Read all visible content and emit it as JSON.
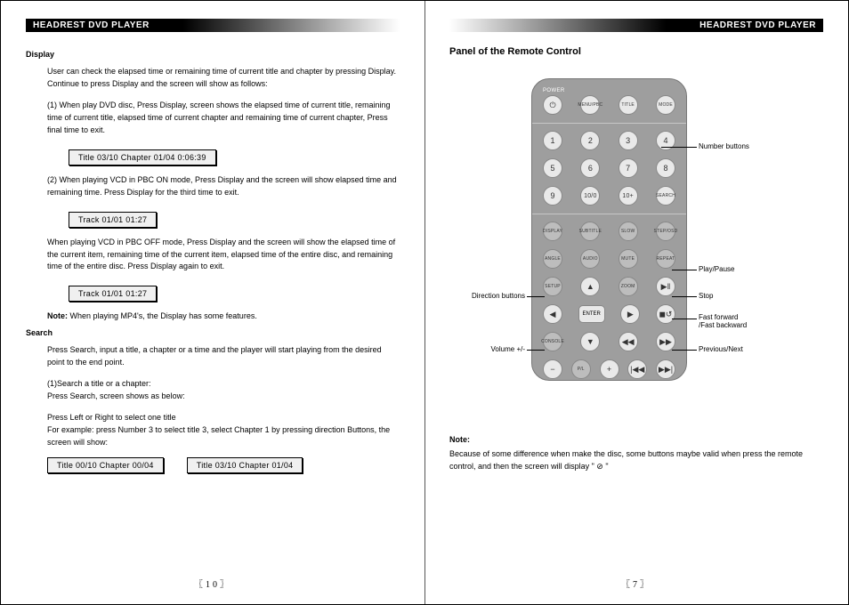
{
  "header": "HEADREST DVD PLAYER",
  "left": {
    "pageNumber": "〖10〗",
    "display": {
      "title": "Display",
      "p1": "User can check the elapsed time or remaining time of current title and chapter by pressing Display. Continue to press Display and the screen will show as follows:",
      "p2": "(1) When play DVD disc, Press Display, screen shows the elapsed time of current title, remaining time of current title, elapsed time of current chapter and remaining time of current chapter, Press final time to exit.",
      "box1": "Title 03/10 Chapter 01/04    0:06:39",
      "p3": "(2) When playing VCD in PBC ON mode, Press Display and the screen will show elapsed time and remaining time. Press Display for the third time to exit.",
      "box2": "Track    01/01     01:27",
      "p4": "When playing VCD in PBC OFF mode, Press Display and the  screen will show the elapsed time of the current item, remaining time of the current item, elapsed time of the entire disc, and remaining time of the entire disc. Press Display again to exit.",
      "box3": "Track    01/01     01:27",
      "noteLabel": "Note:",
      "noteText": " When playing MP4's, the Display has some features."
    },
    "search": {
      "title": "Search",
      "p1": "Press Search, input a title, a chapter or a time and the player will start playing from the desired point to the end point.",
      "p2a": "(1)Search a title or a chapter:",
      "p2b": "Press Search, screen shows as below:",
      "p3a": "Press Left or Right to select one title",
      "p3b": "For example: press Number 3 to select title 3, select Chapter 1 by pressing direction Buttons, the screen will show:",
      "boxA": "Title 00/10   Chapter  00/04",
      "boxB": "Title 03/10   Chapter  01/04"
    }
  },
  "right": {
    "pageNumber": "〖7〗",
    "panelTitle": "Panel of the Remote Control",
    "remote": {
      "powerLabel": "POWER",
      "row1": [
        "MENU/PBC",
        "TITLE",
        "MODE"
      ],
      "numbers": [
        "1",
        "2",
        "3",
        "4",
        "5",
        "6",
        "7",
        "8",
        "9",
        "10/0",
        "10+"
      ],
      "search": "SEARCH",
      "row4": [
        "DISPLAY",
        "SUBTITLE",
        "SLOW",
        "STEP/OSD"
      ],
      "row5": [
        "ANGLE",
        "AUDIO",
        "MUTE",
        "REPEAT"
      ],
      "row6": {
        "setup": "SETUP",
        "zoom": "ZOOM"
      },
      "enter": "ENTER",
      "row8": {
        "console": "CONSOLE"
      },
      "row9": {
        "pl": "P/L"
      }
    },
    "callouts": {
      "numbers": "Number buttons",
      "play": "Play/Pause",
      "direction": "Direction buttons",
      "stop": "Stop",
      "ff": "Fast forward\n/Fast backward",
      "volume": "Volume +/-",
      "prev": "Previous/Next"
    },
    "note": {
      "label": "Note:",
      "text": "Because of some difference when make the disc, some buttons maybe valid when press the remote control, and then the screen will display \" ⊘ \""
    }
  }
}
